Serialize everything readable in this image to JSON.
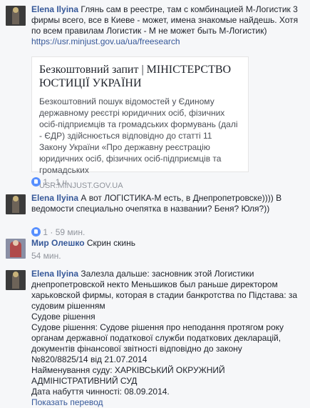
{
  "comments": [
    {
      "author": "Elena Ilyina",
      "text": "Глянь сам в реестре, там с комбинацией М-Логистик 3 фирмы всего, все в Киеве - может, имена знакомые найдешь. Хотя по всем правилам Логистик - М не может быть М-Логистик)",
      "url": "https://usr.minjust.gov.ua/ua/freesearch",
      "preview": {
        "title": "Безкоштовний запит | МІНІСТЕРСТВО ЮСТИЦІЇ УКРАЇНИ",
        "description": "Безкоштовний пошук відомостей у Єдиному державному реєстрі юридичних осіб, фізичних осіб-підприємців та громадських формувань (далі - ЄДР) здійснюється відповідно до статті 11 Закону України «Про державну реєстрацію юридичних осіб, фізичних осіб-підприємців та громадських",
        "domain": "USR.MINJUST.GOV.UA"
      },
      "likes": "1",
      "sep": "·",
      "time": "1 ч"
    },
    {
      "author": "Elena Ilyina",
      "text": "А вот ЛОГІСТИКА-М есть, в Днепропетровске)))) В ведомости специально очепятка в названии? Беня? Юля?))",
      "likes": "1",
      "sep": "·",
      "time": "59 мин."
    },
    {
      "author": "Мир Олешко",
      "text": "Скрин скинь",
      "time": "54 мин."
    },
    {
      "author": "Elena Ilyina",
      "text_lines": [
        "Залезла дальше: засновник этой Логистики",
        "днепропетровской некто Меньшиков был раньше директором",
        "харьковской фирмы, которая в стадии банкротства по Підстава: за",
        "судовим рішенням",
        "Судове рішення",
        "Судове рішення: Судове рішення про неподання протягом року",
        "органам державної податкової служби податкових декларацій,",
        "документів фінансової звітності відповідно до закону",
        "№820/8825/14 від 21.07.2014",
        "Найменування суду: ХАРКІВСЬКИЙ ОКРУЖНИЙ",
        "АДМІНІСТРАТИВНИЙ СУД",
        "Дата набуття чинності: 08.09.2014."
      ],
      "see_translation": "Показать перевод"
    }
  ]
}
